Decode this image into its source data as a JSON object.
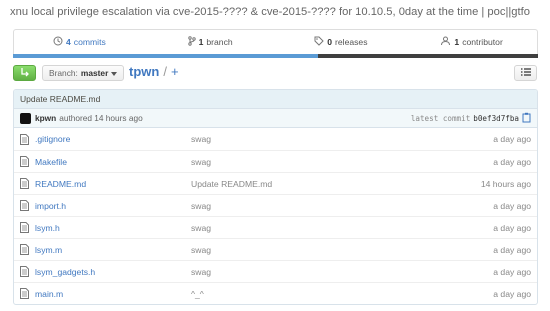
{
  "repo": {
    "description": "xnu local privilege escalation via cve-2015-???? & cve-2015-???? for 10.10.5, 0day at the time | poc||gtfo",
    "name": "tpwn",
    "plus": "+"
  },
  "summary": {
    "commits_count": "4",
    "commits_label": "commits",
    "branches_count": "1",
    "branches_label": "branch",
    "releases_count": "0",
    "releases_label": "releases",
    "contributors_count": "1",
    "contributors_label": "contributor"
  },
  "toolbar": {
    "branch_prefix": "Branch:",
    "branch_name": "master"
  },
  "commit": {
    "title": "Update README.md",
    "author": "kpwn",
    "authored": "authored 14 hours ago",
    "latest_label": "latest commit",
    "sha": "b0ef3d7fba"
  },
  "files": [
    {
      "name": ".gitignore",
      "message": "swag",
      "age": "a day ago"
    },
    {
      "name": "Makefile",
      "message": "swag",
      "age": "a day ago"
    },
    {
      "name": "README.md",
      "message": "Update README.md",
      "age": "14 hours ago"
    },
    {
      "name": "import.h",
      "message": "swag",
      "age": "a day ago"
    },
    {
      "name": "lsym.h",
      "message": "swag",
      "age": "a day ago"
    },
    {
      "name": "lsym.m",
      "message": "swag",
      "age": "a day ago"
    },
    {
      "name": "lsym_gadgets.h",
      "message": "swag",
      "age": "a day ago"
    },
    {
      "name": "main.m",
      "message": "^_^",
      "age": "a day ago"
    }
  ],
  "colors": {
    "link": "#4078c0",
    "sync_green": "#60b044",
    "lang_c": "#5b9bd5",
    "lang_objc": "#3f3f3f"
  },
  "icons": [
    "history-icon",
    "branch-icon",
    "tag-icon",
    "organization-icon",
    "sync-icon",
    "caret-down-icon",
    "list-icon",
    "clippy-icon",
    "file-text-icon"
  ]
}
